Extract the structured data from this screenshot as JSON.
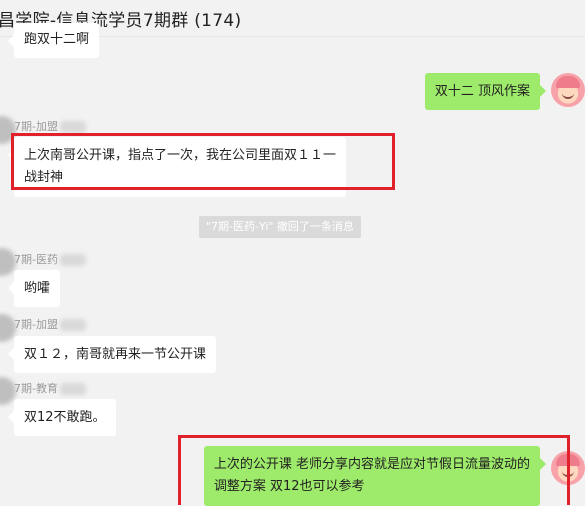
{
  "window": {
    "title": "昌学院-信息流学员7期群 (174)"
  },
  "colors": {
    "outgoing_bubble": "#9eea6a",
    "incoming_bubble": "#ffffff",
    "highlight": "#e0202a"
  },
  "messages": [
    {
      "direction": "incoming",
      "sender": "",
      "text": "跑双十二啊",
      "partial": true
    },
    {
      "direction": "outgoing",
      "text": "双十二 顶风作案"
    },
    {
      "direction": "incoming",
      "sender": "7期-加盟",
      "lines": [
        "上次南哥公开课，指点了一次，我在公司里面双１１一",
        "战封神"
      ],
      "highlighted": true
    },
    {
      "direction": "incoming",
      "sender": "7期-医药",
      "text": "哟嚯"
    },
    {
      "direction": "incoming",
      "sender": "7期-加盟",
      "text": "双１２，南哥就再来一节公开课"
    },
    {
      "direction": "incoming",
      "sender": "7期-教育",
      "text": "双12不敢跑。"
    },
    {
      "direction": "outgoing",
      "lines": [
        "上次的公开课 老师分享内容就是应对节假日流量波动的",
        "调整方案  双12也可以参考"
      ],
      "highlighted": true
    }
  ],
  "system_notice": "\"7期-医药-Yi\" 撤回了一条消息"
}
